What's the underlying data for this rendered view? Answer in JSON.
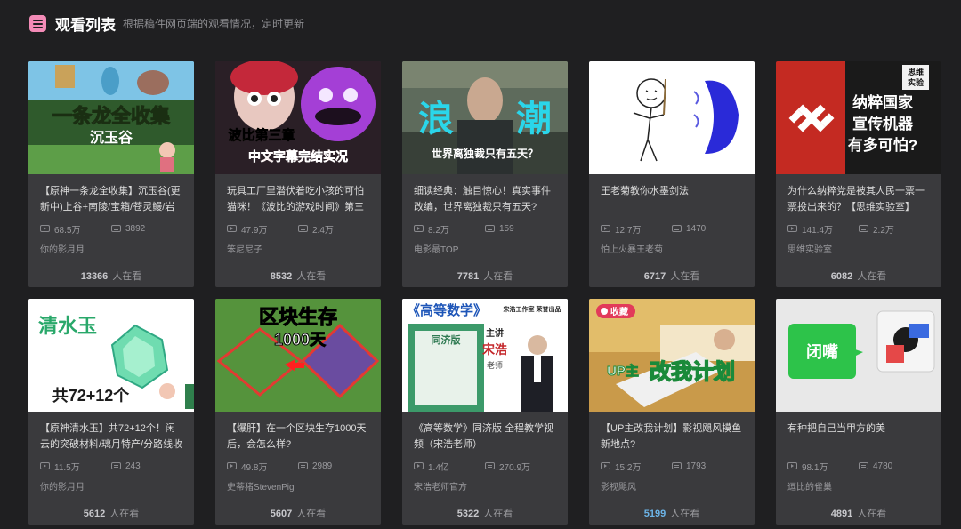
{
  "header": {
    "title": "观看列表",
    "subtitle": "根据稿件网页端的观看情况，定时更新"
  },
  "watching_suffix": "人在看",
  "cards": [
    {
      "title": "【原神一条龙全收集】沉玉谷(更新中)上谷+南陵/宝箱/苍灵鳗/岩之",
      "views": "68.5万",
      "danmaku": "3892",
      "uploader": "你的影月月",
      "watching": "13366",
      "thumb_text": [
        "一条龙全收集",
        "沉玉谷"
      ]
    },
    {
      "title": "玩具工厂里潜伏着吃小孩的可怕猫咪！《波比的游戏时间》第三章中",
      "views": "47.9万",
      "danmaku": "2.4万",
      "uploader": "笨尼尼子",
      "watching": "8532",
      "thumb_text": [
        "波比第三章",
        "中文字幕完结实况"
      ]
    },
    {
      "title": "细读经典：触目惊心！真实事件改编，世界离独裁只有五天?",
      "views": "8.2万",
      "danmaku": "159",
      "uploader": "电影最TOP",
      "watching": "7781",
      "thumb_text": [
        "浪",
        "潮",
        "世界离独裁只有五天？"
      ]
    },
    {
      "title": "王老菊教你水墨剑法",
      "views": "12.7万",
      "danmaku": "1470",
      "uploader": "怕上火暴王老菊",
      "watching": "6717",
      "thumb_text": []
    },
    {
      "title": "为什么纳粹党是被其人民一票一票投出来的？【思维实验室】",
      "views": "141.4万",
      "danmaku": "2.2万",
      "uploader": "思维实验室",
      "watching": "6082",
      "thumb_text": [
        "纳粹国家",
        "宣传机器",
        "有多可怕?",
        "思维",
        "实验"
      ]
    },
    {
      "title": "【原神清水玉】共72+12个！闲云的突破材料/璃月特产/分路线收",
      "views": "11.5万",
      "danmaku": "243",
      "uploader": "你的影月月",
      "watching": "5612",
      "thumb_text": [
        "清水玉",
        "共72+12个"
      ]
    },
    {
      "title": "【爆肝】在一个区块生存1000天后，会怎么样?",
      "views": "49.8万",
      "danmaku": "2989",
      "uploader": "史蒂猪StevenPig",
      "watching": "5607",
      "thumb_text": [
        "区块生存",
        "1000天"
      ]
    },
    {
      "title": "《高等数学》同济版 全程教学视频（宋浩老师）",
      "views": "1.4亿",
      "danmaku": "270.9万",
      "uploader": "宋浩老师官方",
      "watching": "5322",
      "thumb_text": [
        "《高等数学》",
        "宋浩工作室 荣誉出品",
        "同济版",
        "主讲",
        "宋浩",
        "老师"
      ]
    },
    {
      "title": "【UP主改我计划】影视飓风摸鱼新地点?",
      "views": "15.2万",
      "danmaku": "1793",
      "uploader": "影视飓风",
      "watching": "5199",
      "thumb_text": [
        "收藏",
        "UP主",
        "改我计划"
      ]
    },
    {
      "title": "有种把自己当甲方的美",
      "views": "98.1万",
      "danmaku": "4780",
      "uploader": "逗比的雀巢",
      "watching": "4891",
      "thumb_text": [
        "闭嘴"
      ]
    }
  ]
}
